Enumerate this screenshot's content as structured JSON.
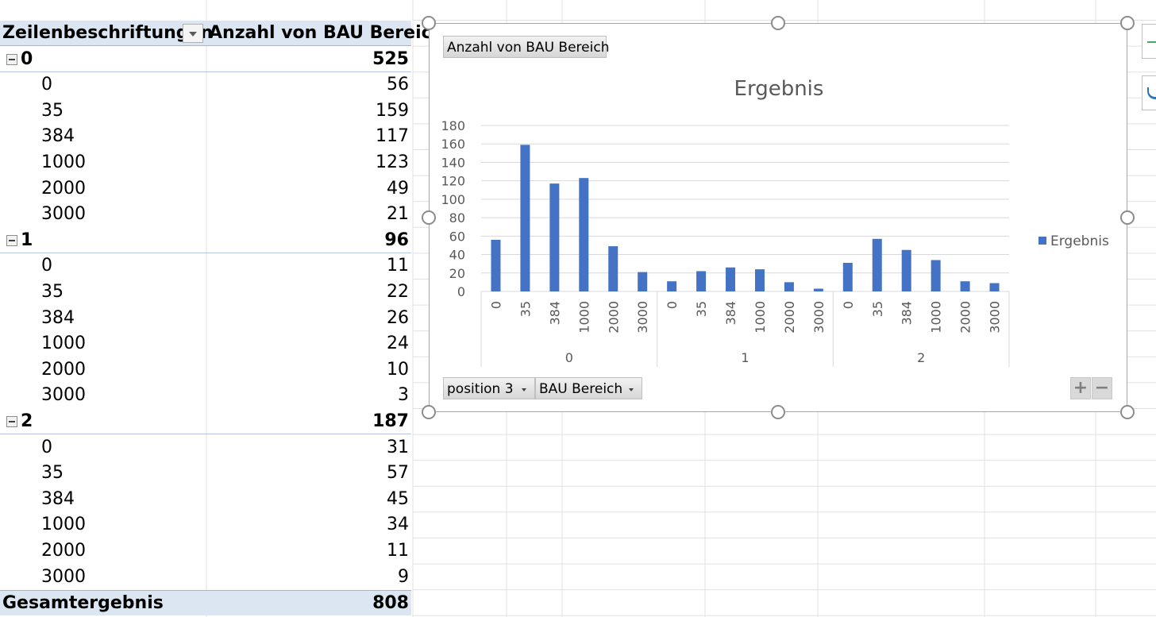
{
  "pivot": {
    "header_row_label": "Zeilenbeschriftungen",
    "header_value": "Anzahl von BAU Bereich",
    "groups": [
      {
        "label": "0",
        "total": "525",
        "items": [
          {
            "label": "0",
            "value": "56"
          },
          {
            "label": "35",
            "value": "159"
          },
          {
            "label": "384",
            "value": "117"
          },
          {
            "label": "1000",
            "value": "123"
          },
          {
            "label": "2000",
            "value": "49"
          },
          {
            "label": "3000",
            "value": "21"
          }
        ]
      },
      {
        "label": "1",
        "total": "96",
        "items": [
          {
            "label": "0",
            "value": "11"
          },
          {
            "label": "35",
            "value": "22"
          },
          {
            "label": "384",
            "value": "26"
          },
          {
            "label": "1000",
            "value": "24"
          },
          {
            "label": "2000",
            "value": "10"
          },
          {
            "label": "3000",
            "value": "3"
          }
        ]
      },
      {
        "label": "2",
        "total": "187",
        "items": [
          {
            "label": "0",
            "value": "31"
          },
          {
            "label": "35",
            "value": "57"
          },
          {
            "label": "384",
            "value": "45"
          },
          {
            "label": "1000",
            "value": "34"
          },
          {
            "label": "2000",
            "value": "11"
          },
          {
            "label": "3000",
            "value": "9"
          }
        ]
      }
    ],
    "grand_total_label": "Gesamtergebnis",
    "grand_total_value": "808"
  },
  "chart": {
    "value_field_button": "Anzahl von BAU Bereich",
    "axis_field_buttons": [
      "position 3",
      "BAU Bereich"
    ],
    "zoom_plus": "+",
    "zoom_minus": "−"
  },
  "chart_data": {
    "type": "bar",
    "title": "Ergebnis",
    "legend": "right",
    "grid": true,
    "ylim": [
      0,
      180
    ],
    "yticks": [
      0,
      20,
      40,
      60,
      80,
      100,
      120,
      140,
      160,
      180
    ],
    "groups": [
      "0",
      "1",
      "2"
    ],
    "categories": [
      "0",
      "35",
      "384",
      "1000",
      "2000",
      "3000"
    ],
    "series": [
      {
        "name": "Ergebnis",
        "values": [
          56,
          159,
          117,
          123,
          49,
          21,
          11,
          22,
          26,
          24,
          10,
          3,
          31,
          57,
          45,
          34,
          11,
          9
        ]
      }
    ],
    "bar_color": "#4472c4"
  },
  "colors": {
    "pivot_header": "#dce6f2",
    "grid_line": "#d9d9d9",
    "chart_border": "#a6a6a6"
  }
}
